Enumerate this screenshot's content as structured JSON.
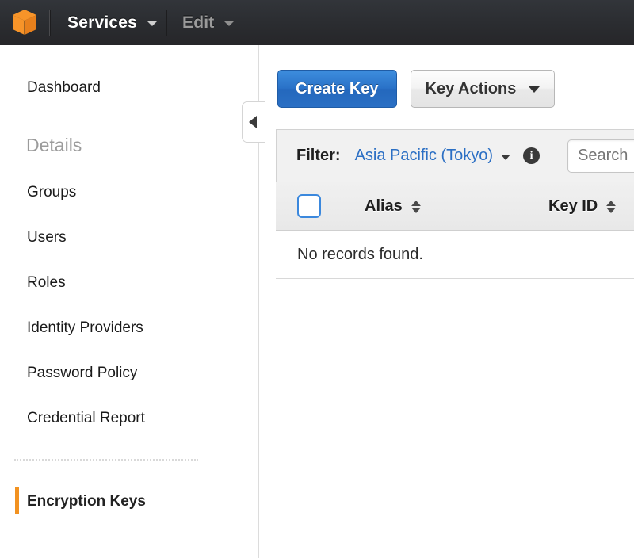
{
  "topnav": {
    "logo_icon": "aws-cube-logo",
    "services_label": "Services",
    "services_caret_icon": "chevron-down-icon",
    "edit_label": "Edit",
    "edit_caret_icon": "chevron-down-icon"
  },
  "sidebar": {
    "dashboard_label": "Dashboard",
    "section_label": "Details",
    "items": [
      {
        "label": "Groups"
      },
      {
        "label": "Users"
      },
      {
        "label": "Roles"
      },
      {
        "label": "Identity Providers"
      },
      {
        "label": "Password Policy"
      },
      {
        "label": "Credential Report"
      }
    ],
    "active_item_label": "Encryption Keys",
    "collapse_icon": "triangle-left-icon"
  },
  "toolbar": {
    "create_key_label": "Create Key",
    "key_actions_label": "Key Actions",
    "key_actions_caret_icon": "caret-down-icon"
  },
  "filter": {
    "label": "Filter:",
    "region_value": "Asia Pacific (Tokyo)",
    "region_caret_icon": "caret-down-icon",
    "info_icon": "info-circle-icon",
    "info_glyph": "i",
    "search_placeholder": "Search",
    "search_value": ""
  },
  "table": {
    "select_all_checkbox": "select-all-checkbox",
    "columns": [
      {
        "label": "Alias",
        "sort_icon": "sort-arrows-icon"
      },
      {
        "label": "Key ID",
        "sort_icon": "sort-arrows-icon"
      }
    ],
    "empty_message": "No records found."
  },
  "colors": {
    "accent_orange": "#f29221",
    "primary_blue": "#2a72c8",
    "link_blue": "#2b6fc4",
    "topbar_dark": "#2b2d31"
  }
}
